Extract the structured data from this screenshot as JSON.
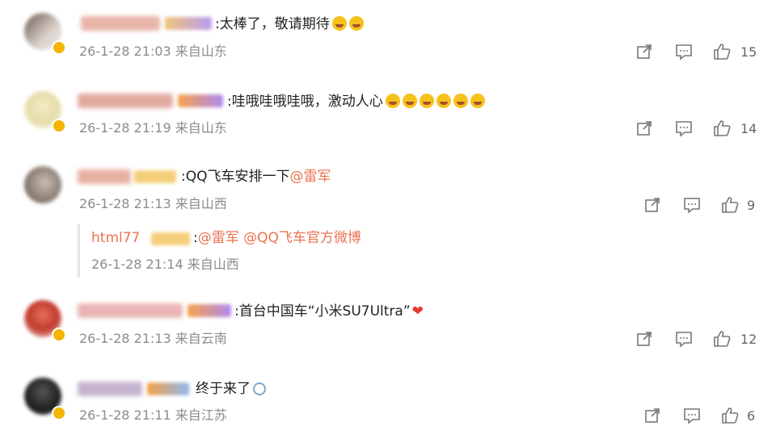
{
  "comments": [
    {
      "text": ":太棒了，敬请期待",
      "emoji_count": 2,
      "time": "26-1-28 21:03",
      "location": "来自山东",
      "likes": "15"
    },
    {
      "text": ":哇哦哇哦哇哦，激动人心",
      "emoji_count": 6,
      "time": "26-1-28 21:19",
      "location": "来自山东",
      "likes": "14"
    },
    {
      "username": "html77",
      "text_prefix": ":QQ飞车安排一下",
      "mention": "@雷军",
      "time": "26-1-28 21:13",
      "location": "来自山西",
      "likes": "9",
      "reply": {
        "username": "html77",
        "text_prefix": ":",
        "mention1": "@雷军",
        "mention2": "@QQ飞车官方微博",
        "time": "26-1-28 21:14",
        "location": "来自山西"
      }
    },
    {
      "text": ":首台中国车“小米SU7Ultra”",
      "time": "26-1-28 21:13",
      "location": "来自云南",
      "likes": "12"
    },
    {
      "text": "终于来了",
      "time": "26-1-28 21:11",
      "location": "来自江苏",
      "likes": "6"
    }
  ],
  "icons": {
    "repost": "share-icon",
    "comment": "comment-icon",
    "like": "thumbs-up-icon"
  },
  "colors": {
    "mention": "#eb7350",
    "meta": "#8c8c8c",
    "text": "#222222"
  }
}
